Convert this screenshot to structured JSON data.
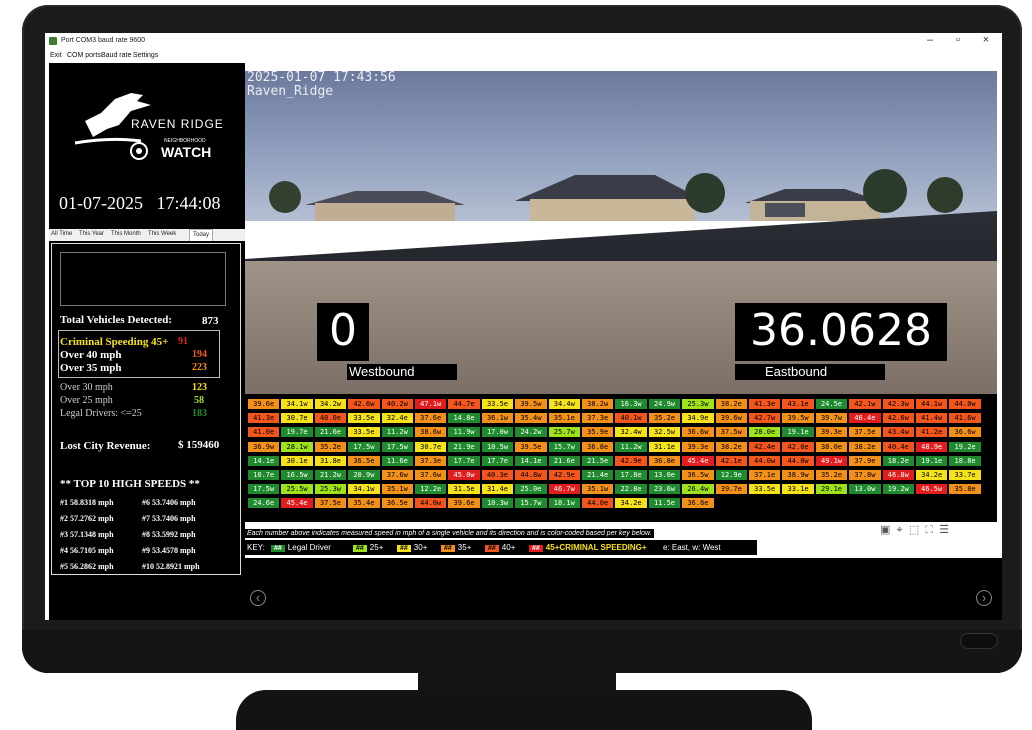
{
  "window": {
    "title": "Port COM3 baud rate 9600",
    "controls": [
      "–",
      "▫",
      "×"
    ]
  },
  "menu": [
    "Exit",
    "COM ports",
    "Baud rate",
    "Settings"
  ],
  "logo": {
    "name": "RAVEN RIDGE",
    "sub1": "NEIGHBORHOOD",
    "sub2": "WATCH"
  },
  "datetime": {
    "date": "01-07-2025",
    "time": "17:44:08"
  },
  "tabs": [
    "All Time",
    "This Year",
    "This Month",
    "This Week",
    "Today"
  ],
  "stats": {
    "total_label": "Total Vehicles Detected:",
    "total_value": "873",
    "criminal_label": "Criminal Speeding 45+",
    "criminal_value": "91",
    "over40_label": "Over 40 mph",
    "over40_value": "194",
    "over35_label": "Over 35 mph",
    "over35_value": "223",
    "over30_label": "Over 30 mph",
    "over30_value": "123",
    "over25_label": "Over 25 mph",
    "over25_value": "58",
    "legal_label": "Legal Drivers: <=25",
    "legal_value": "183",
    "revenue_label": "Lost City Revenue:",
    "revenue_value": "$ 159460",
    "top10_title": "** TOP 10 HIGH SPEEDS **",
    "top10": [
      "#1 58.8318 mph",
      "#6 53.7406 mph",
      "#2 57.2762 mph",
      "#7 53.7406 mph",
      "#3 57.1348 mph",
      "#8 53.5992 mph",
      "#4 56.7105 mph",
      "#9 53.4578 mph",
      "#5 56.2862 mph",
      "#10 52.8921 mph"
    ]
  },
  "camera": {
    "timestamp": "2025-01-07 17:43:56",
    "location": "Raven_Ridge",
    "westbound_speed": "0",
    "westbound_label": "Westbound",
    "eastbound_speed": "36.0628",
    "eastbound_label": "Eastbound"
  },
  "colors": {
    "legal": "#1f8a2e",
    "s25": "#9ee21c",
    "s30": "#f6e21b",
    "s35": "#f39019",
    "s40": "#f2561c",
    "s45": "#e21d1d"
  },
  "grid": [
    [
      "39.6e",
      "34.1w",
      "34.2w",
      "42.6w",
      "40.2w",
      "47.1w",
      "44.7e",
      "33.5e",
      "39.5w",
      "34.4w",
      "38.2w",
      "16.3w",
      "24.9w",
      "25.3w",
      "38.2e",
      "41.3e",
      "43.1e",
      "24.5e",
      "42.1w",
      "42.3w",
      "44.1w",
      "44.0w"
    ],
    [
      "41.3e",
      "30.7e",
      "40.0e",
      "33.5e",
      "32.4e",
      "37.6e",
      "14.8e",
      "36.1w",
      "35.4w",
      "35.1e",
      "37.3e",
      "40.1w",
      "35.2e",
      "34.9e",
      "39.6w",
      "42.7w",
      "39.5w",
      "39.7w",
      "46.4e",
      "42.6w",
      "41.4w",
      "41.6w"
    ],
    [
      "41.0e",
      "19.7e",
      "21.6e",
      "33.5e",
      "11.2w",
      "38.6w",
      "11.9w",
      "17.0w",
      "24.2w",
      "25.7w",
      "35.9e",
      "32.4w",
      "32.5w",
      "36.6w",
      "37.5w",
      "28.0e",
      "19.1e",
      "39.3e",
      "37.5e",
      "43.4w",
      "41.2e",
      "36.6w"
    ],
    [
      "36.9w",
      "28.1w",
      "35.2e",
      "17.5w",
      "17.5w",
      "30.7e",
      "21.9e",
      "10.5w",
      "39.5e",
      "15.7w",
      "36.8e",
      "11.2w",
      "31.1e",
      "39.3e",
      "38.2e",
      "42.4e",
      "42.0e",
      "38.0e",
      "38.2e",
      "40.4e",
      "48.9e",
      "19.2e"
    ],
    [
      "14.1e",
      "30.1e",
      "31.8e",
      "36.5e",
      "11.6e",
      "37.3e",
      "17.7e",
      "17.7e",
      "14.1e",
      "21.6e",
      "21.5e",
      "42.9e",
      "36.8e",
      "45.4e",
      "42.1e",
      "44.0w",
      "44.0w",
      "49.1w",
      "37.9e",
      "18.2e",
      "19.1e",
      "18.8e"
    ],
    [
      "10.7e",
      "16.5w",
      "21.2w",
      "20.9w",
      "37.6w",
      "37.6w",
      "45.0w",
      "40.3e",
      "44.8w",
      "42.9e",
      "21.4e",
      "17.8e",
      "13.0e",
      "36.5w",
      "12.9e",
      "37.1e",
      "38.9w",
      "35.2e",
      "37.8w",
      "46.8w",
      "34.2e",
      "33.7e"
    ],
    [
      "17.5w",
      "25.5w",
      "25.3w",
      "34.1w",
      "35.1w",
      "12.2e",
      "31.5e",
      "31.4e",
      "25.0e",
      "46.7w",
      "35.1w",
      "22.8e",
      "23.6w",
      "26.4w",
      "39.7e",
      "33.5e",
      "33.1e",
      "29.1e",
      "13.0w",
      "19.2w",
      "46.5w",
      "35.8e"
    ],
    [
      "24.6e",
      "45.4e",
      "37.5e",
      "35.4e",
      "36.5e",
      "44.0w",
      "39.6e",
      "10.3w",
      "15.7w",
      "18.1w",
      "44.0e",
      "34.2e",
      "11.5e",
      "36.8e"
    ]
  ],
  "note": "Each number above indicates measured speed in mph of a single vehicle and its direction and is color-coded based per key below.",
  "key": {
    "prefix": "KEY:",
    "swatch_text": "##",
    "legal": "Legal Driver",
    "s25": "25+",
    "s30": "30+",
    "s35": "35+",
    "s40": "40+",
    "s45": "45+CRIMINAL SPEEDING+",
    "dir": "e: East, w: West"
  },
  "icons": [
    "window-icon",
    "cast-icon",
    "crop-icon",
    "fullscreen-icon",
    "menu-icon",
    "prev-arrow-icon",
    "next-arrow-icon"
  ]
}
